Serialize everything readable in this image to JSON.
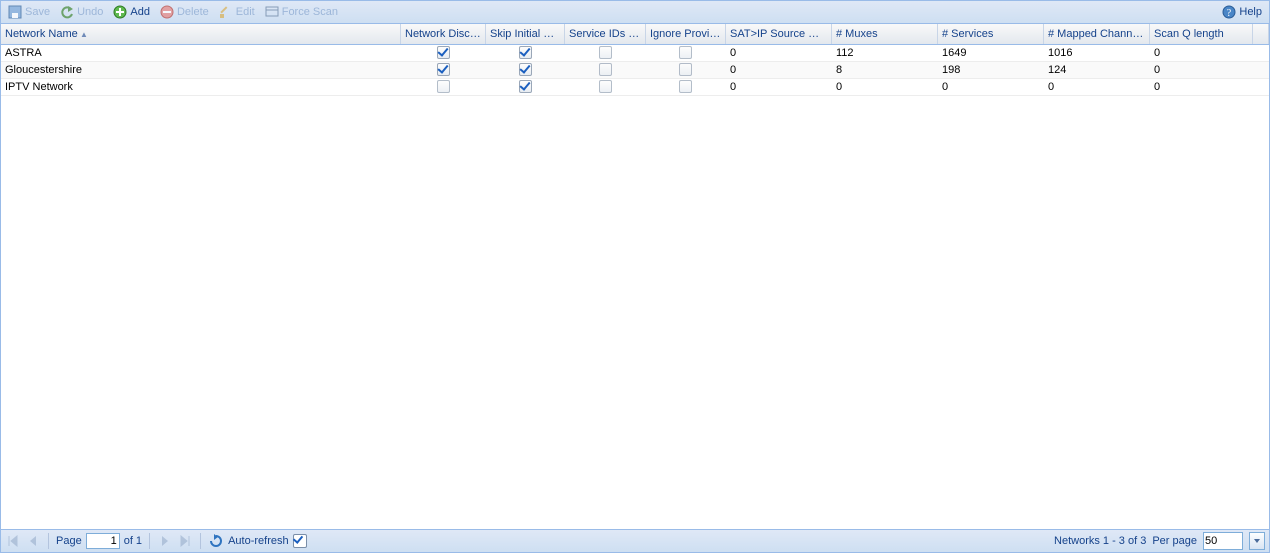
{
  "toolbar": {
    "save": "Save",
    "undo": "Undo",
    "add": "Add",
    "delete": "Delete",
    "edit": "Edit",
    "force_scan": "Force Scan",
    "help": "Help"
  },
  "columns": {
    "c0": "Network Name",
    "c1": "Network Discovery",
    "c2": "Skip Initial Scan",
    "c3": "Service IDs as C...",
    "c4": "Ignore Provider's...",
    "c5": "SAT>IP Source Number",
    "c6": "# Muxes",
    "c7": "# Services",
    "c8": "# Mapped Channels",
    "c9": "Scan Q length"
  },
  "rows": [
    {
      "name": "ASTRA",
      "discovery": true,
      "skip": true,
      "service_ids": false,
      "ignore_provider": false,
      "satip": "0",
      "muxes": "112",
      "services": "1649",
      "mapped": "1016",
      "scanq": "0"
    },
    {
      "name": "Gloucestershire",
      "discovery": true,
      "skip": true,
      "service_ids": false,
      "ignore_provider": false,
      "satip": "0",
      "muxes": "8",
      "services": "198",
      "mapped": "124",
      "scanq": "0"
    },
    {
      "name": "IPTV Network",
      "discovery": false,
      "skip": true,
      "service_ids": false,
      "ignore_provider": false,
      "satip": "0",
      "muxes": "0",
      "services": "0",
      "mapped": "0",
      "scanq": "0"
    }
  ],
  "paging": {
    "page_label": "Page",
    "page_current": "1",
    "of_label": "of 1",
    "auto_refresh": "Auto-refresh",
    "status": "Networks 1 - 3 of 3",
    "per_page_label": "Per page",
    "per_page_value": "50"
  }
}
